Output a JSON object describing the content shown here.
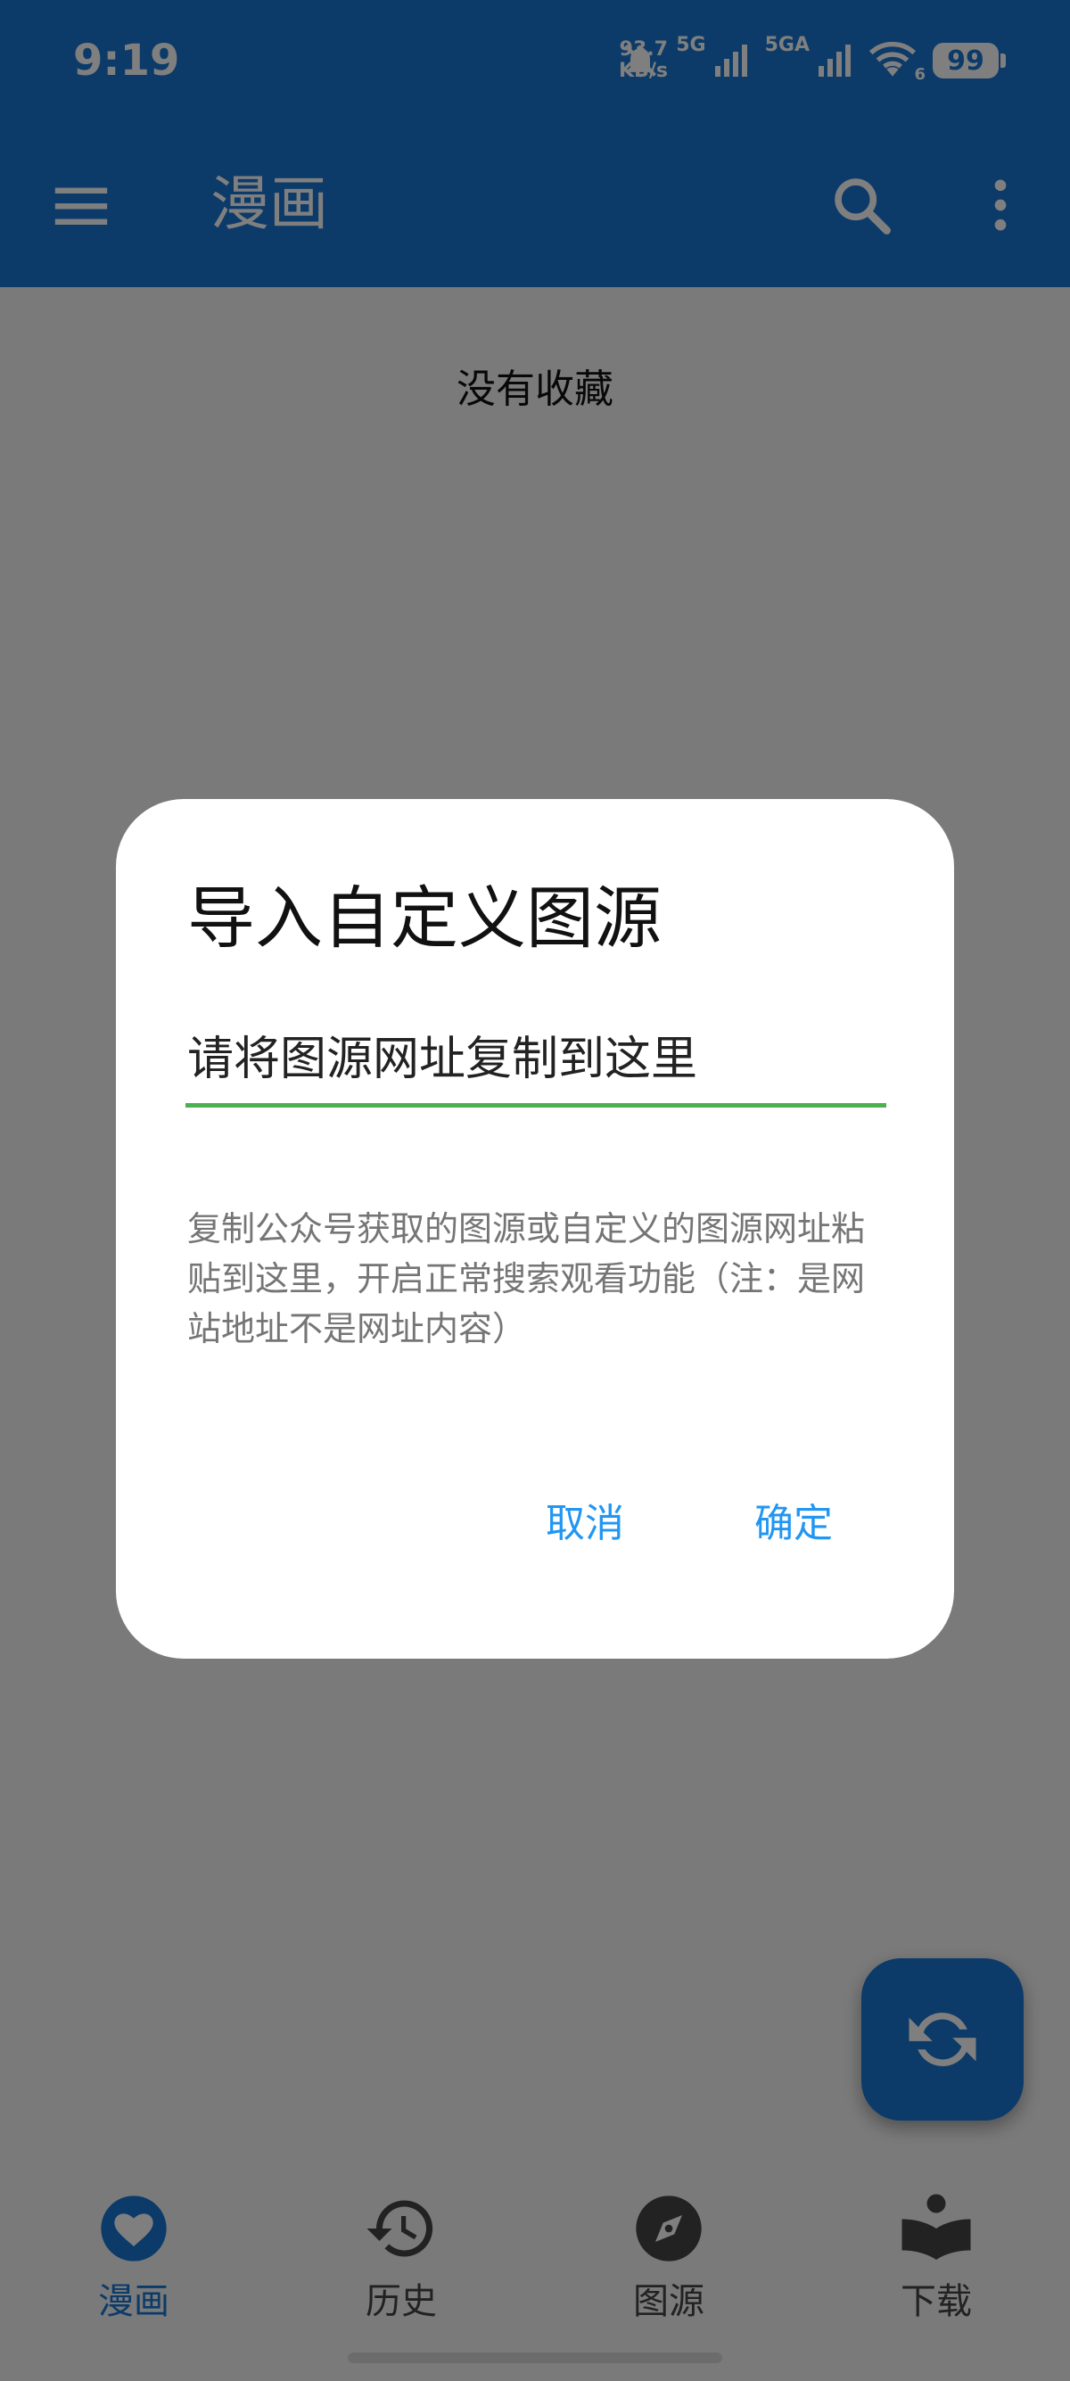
{
  "status_bar": {
    "time": "9:19",
    "speed_value": "93.7",
    "speed_unit": "KB/s",
    "network1": "5G",
    "network2": "5GA",
    "wifi_badge": "6",
    "battery": "99"
  },
  "app_bar": {
    "title": "漫画"
  },
  "content": {
    "empty_message": "没有收藏"
  },
  "dialog": {
    "title": "导入自定义图源",
    "input_placeholder": "请将图源网址复制到这里",
    "input_value": "",
    "hint": "复制公众号获取的图源或自定义的图源网址粘贴到这里，开启正常搜索观看功能（注：是网站地址不是网址内容）",
    "cancel_label": "取消",
    "confirm_label": "确定"
  },
  "bottom_nav": {
    "items": [
      {
        "label": "漫画",
        "icon": "heart-icon",
        "active": true
      },
      {
        "label": "历史",
        "icon": "history-icon",
        "active": false
      },
      {
        "label": "图源",
        "icon": "compass-icon",
        "active": false
      },
      {
        "label": "下载",
        "icon": "book-icon",
        "active": false
      }
    ]
  },
  "colors": {
    "primary": "#1976d2",
    "accent_button": "#2196f3",
    "input_underline": "#4caf50",
    "scrim": "rgba(0,0,0,0.5)"
  }
}
